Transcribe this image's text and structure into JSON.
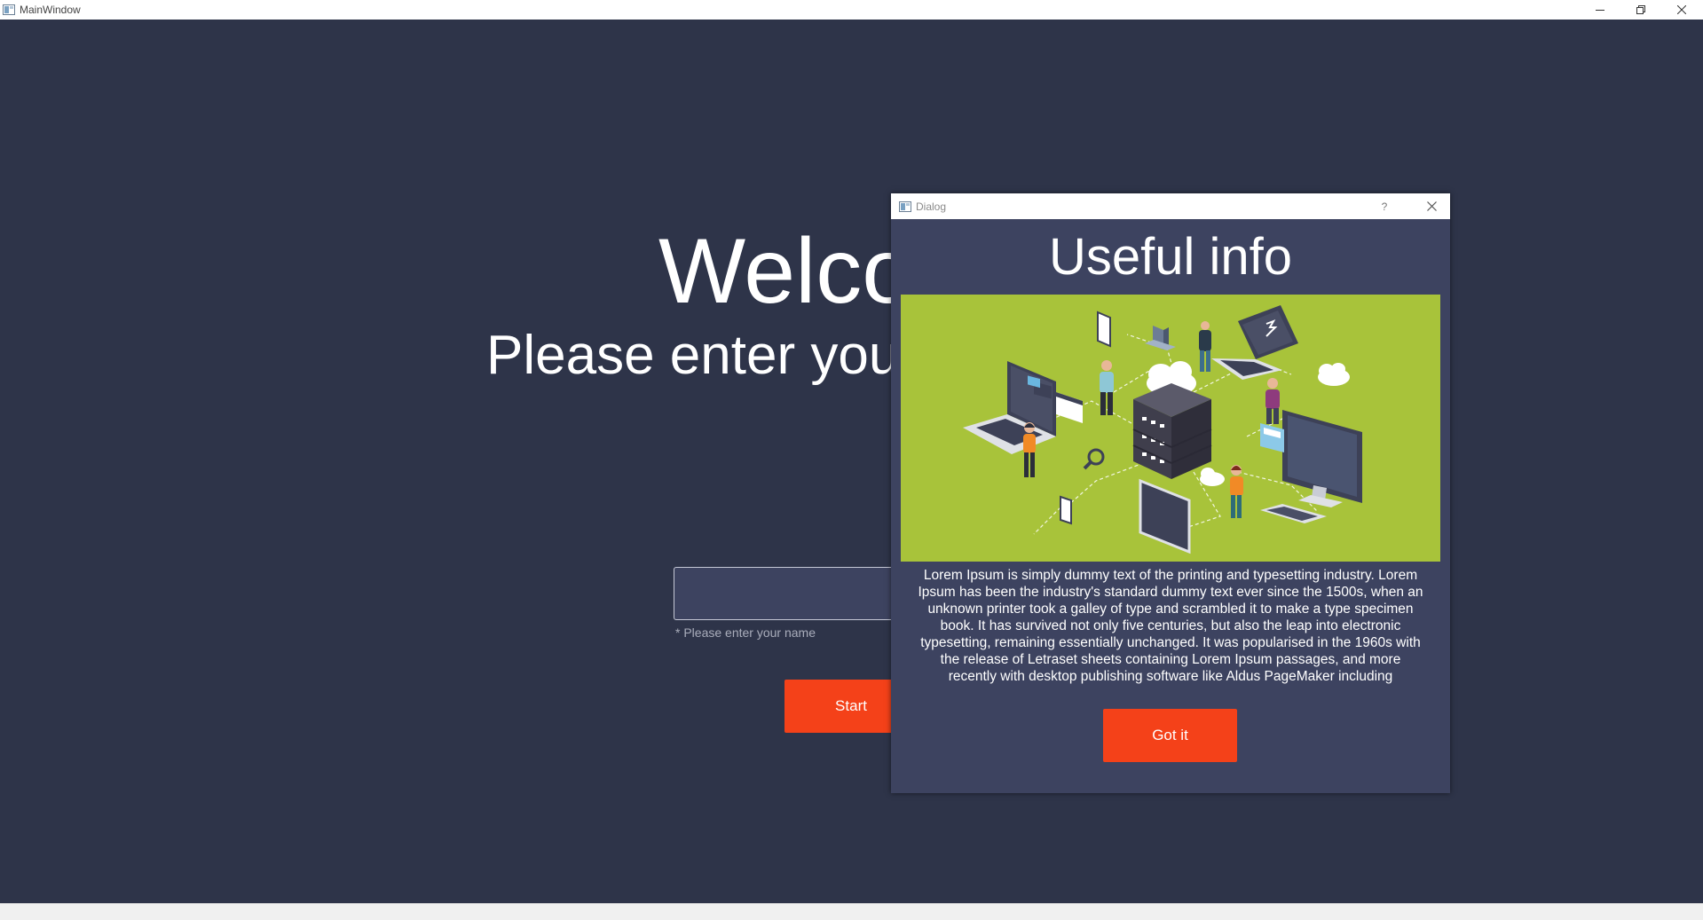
{
  "main_window": {
    "title": "MainWindow",
    "welcome_text": "Welco",
    "prompt_text": "Please enter your",
    "name_input": {
      "value": "",
      "placeholder": ""
    },
    "name_hint": "* Please enter your name",
    "start_label": "Start"
  },
  "dialog": {
    "title": "Dialog",
    "help_label": "?",
    "heading": "Useful info",
    "illustration_icon": "isometric-network-illustration",
    "body": "Lorem Ipsum is simply dummy text of the printing and typesetting industry. Lorem Ipsum has been the industry's standard dummy text ever since the 1500s, when an unknown printer took a galley of type and scrambled it to make a type specimen book. It has survived not only five centuries, but also the leap into electronic typesetting, remaining essentially unchanged. It was popularised in the 1960s with the release of Letraset sheets containing Lorem Ipsum passages, and more recently with desktop publishing software like Aldus PageMaker including",
    "got_it_label": "Got it"
  },
  "colors": {
    "window_bg": "#2e3449",
    "dialog_bg": "#3d4360",
    "accent": "#f44119",
    "illustration_bg": "#a8c33a"
  }
}
